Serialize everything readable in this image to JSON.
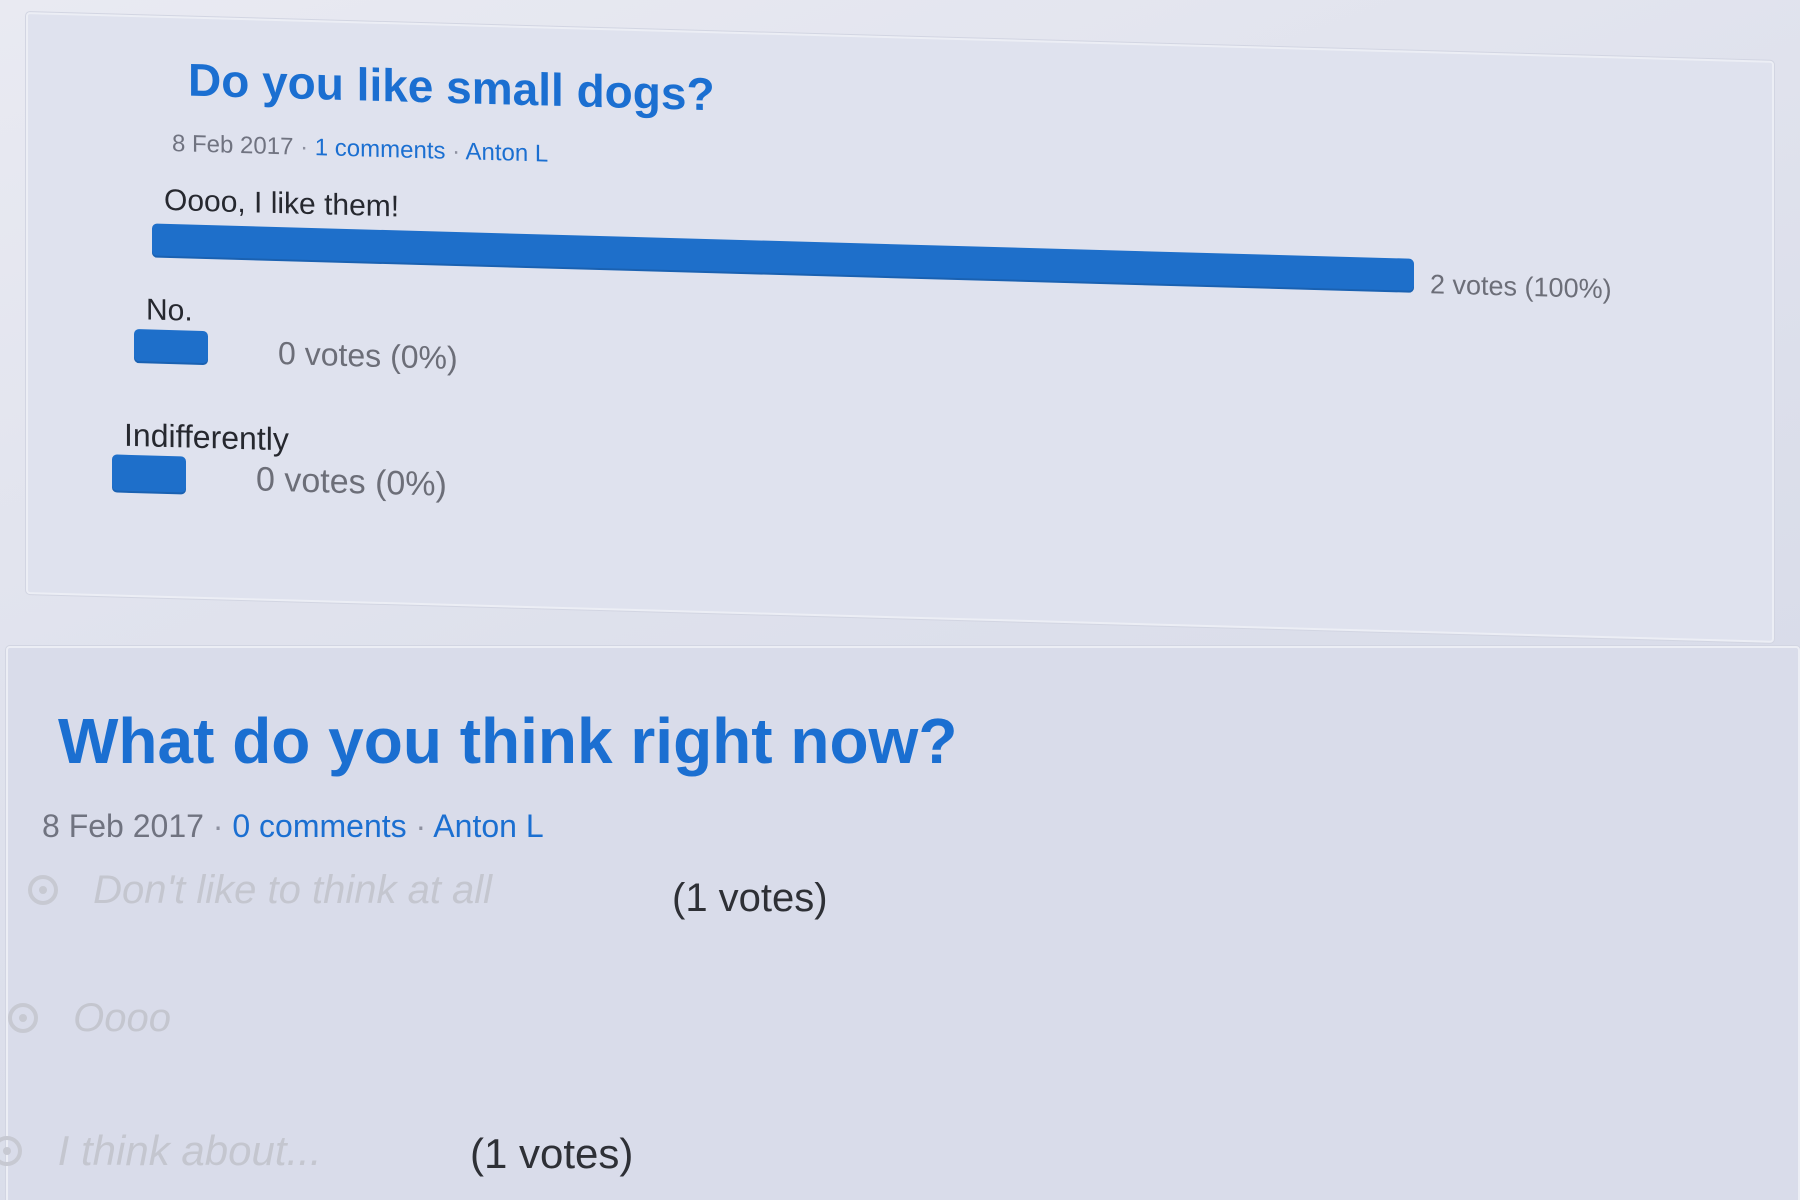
{
  "poll1": {
    "title": "Do you like small dogs?",
    "date": "8 Feb 2017",
    "sep1": "·",
    "comments": "1 comments",
    "sep2": "·",
    "author": "Anton L",
    "options": [
      {
        "label": "Oooo, I like them!",
        "votes_text": "2 votes (100%)",
        "share": 1.0
      },
      {
        "label": "No.",
        "votes_text": "0 votes (0%)",
        "share": 0.0
      },
      {
        "label": "Indifferently",
        "votes_text": "0 votes (0%)",
        "share": 0.0
      }
    ]
  },
  "poll2": {
    "title": "What do you think right now?",
    "date": "8 Feb 2017",
    "sep1": "·",
    "comments": "0 comments",
    "sep2": "·",
    "author": "Anton L",
    "options": [
      {
        "label": "Don't like to think at all",
        "votes_text": "(1 votes)"
      },
      {
        "label": "Oooo",
        "votes_text": ""
      },
      {
        "label": "I think about...",
        "votes_text": "(1 votes)"
      }
    ]
  },
  "colors": {
    "accent": "#1b6fd1",
    "bar": "#1e6fca",
    "background": "#dfe2ee"
  },
  "icons": {
    "radio": "radio-button-icon"
  }
}
